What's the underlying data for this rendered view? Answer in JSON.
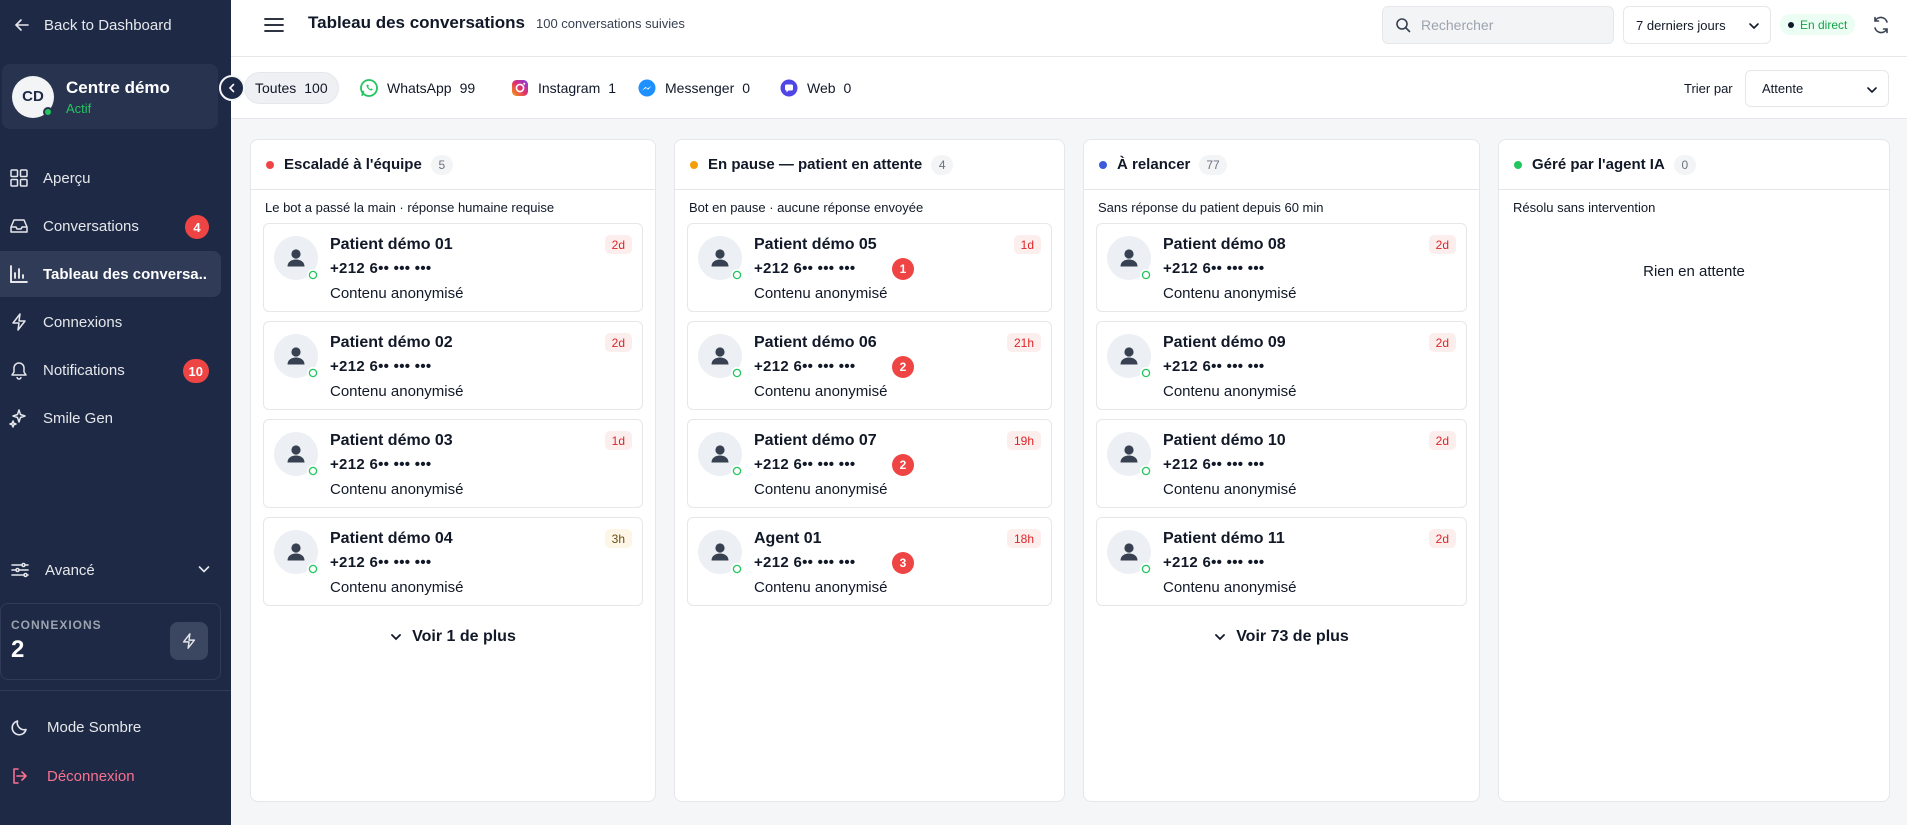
{
  "sidebar": {
    "back_label": "Back to Dashboard",
    "org": {
      "initials": "CD",
      "name": "Centre démo",
      "status": "Actif"
    },
    "items": [
      {
        "key": "apercu",
        "label": "Aperçu",
        "icon": "grid-icon"
      },
      {
        "key": "conversations",
        "label": "Conversations",
        "icon": "inbox-icon",
        "badge": "4"
      },
      {
        "key": "tableau",
        "label": "Tableau des conversa..",
        "icon": "bar-chart-icon",
        "active": true
      },
      {
        "key": "connexions",
        "label": "Connexions",
        "icon": "bolt-icon"
      },
      {
        "key": "notifications",
        "label": "Notifications",
        "icon": "bell-icon",
        "badge": "10"
      },
      {
        "key": "smile",
        "label": "Smile Gen",
        "icon": "sparkles-icon"
      }
    ],
    "advanced_label": "Avancé",
    "connections": {
      "label": "CONNEXIONS",
      "value": "2"
    },
    "dark_mode_label": "Mode Sombre",
    "logout_label": "Déconnexion"
  },
  "header": {
    "title": "Tableau des conversations",
    "subtitle": "100 conversations suivies",
    "search_placeholder": "Rechercher",
    "range_label": "7 derniers jours",
    "live_label": "En direct"
  },
  "filters": {
    "chips": [
      {
        "key": "all",
        "label": "Toutes",
        "count": "100",
        "active": true
      },
      {
        "key": "whatsapp",
        "label": "WhatsApp",
        "count": "99"
      },
      {
        "key": "instagram",
        "label": "Instagram",
        "count": "1"
      },
      {
        "key": "messenger",
        "label": "Messenger",
        "count": "0"
      },
      {
        "key": "web",
        "label": "Web",
        "count": "0"
      }
    ],
    "sort_label": "Trier par",
    "sort_value": "Attente"
  },
  "columns": [
    {
      "key": "escalade",
      "title": "Escaladé à l'équipe",
      "count": "5",
      "dot_color": "#ef4444",
      "description": "Le bot a passé la main · réponse humaine requise",
      "more_label": "Voir 1 de plus",
      "cards": [
        {
          "name": "Patient démo 01",
          "phone": "+212 6•• ••• •••",
          "message": "Contenu anonymisé",
          "age": "2d"
        },
        {
          "name": "Patient démo 02",
          "phone": "+212 6•• ••• •••",
          "message": "Contenu anonymisé",
          "age": "2d"
        },
        {
          "name": "Patient démo 03",
          "phone": "+212 6•• ••• •••",
          "message": "Contenu anonymisé",
          "age": "1d"
        },
        {
          "name": "Patient démo 04",
          "phone": "+212 6•• ••• •••",
          "message": "Contenu anonymisé",
          "age": "3h",
          "age_style": "warm"
        }
      ]
    },
    {
      "key": "pause",
      "title": "En pause — patient en attente",
      "count": "4",
      "dot_color": "#f59e0b",
      "description": "Bot en pause · aucune réponse envoyée",
      "cards": [
        {
          "name": "Patient démo 05",
          "phone": "+212 6•• ••• •••",
          "message": "Contenu anonymisé",
          "age": "1d",
          "unread": "1"
        },
        {
          "name": "Patient démo 06",
          "phone": "+212 6•• ••• •••",
          "message": "Contenu anonymisé",
          "age": "21h",
          "unread": "2"
        },
        {
          "name": "Patient démo 07",
          "phone": "+212 6•• ••• •••",
          "message": "Contenu anonymisé",
          "age": "19h",
          "unread": "2"
        },
        {
          "name": "Agent 01",
          "phone": "+212 6•• ••• •••",
          "message": "Contenu anonymisé",
          "age": "18h",
          "unread": "3"
        }
      ]
    },
    {
      "key": "relancer",
      "title": "À relancer",
      "count": "77",
      "dot_color": "#3b5bdb",
      "description": "Sans réponse du patient depuis 60 min",
      "more_label": "Voir 73 de plus",
      "cards": [
        {
          "name": "Patient démo 08",
          "phone": "+212 6•• ••• •••",
          "message": "Contenu anonymisé",
          "age": "2d"
        },
        {
          "name": "Patient démo 09",
          "phone": "+212 6•• ••• •••",
          "message": "Contenu anonymisé",
          "age": "2d"
        },
        {
          "name": "Patient démo 10",
          "phone": "+212 6•• ••• •••",
          "message": "Contenu anonymisé",
          "age": "2d"
        },
        {
          "name": "Patient démo 11",
          "phone": "+212 6•• ••• •••",
          "message": "Contenu anonymisé",
          "age": "2d"
        }
      ]
    },
    {
      "key": "ia",
      "title": "Géré par l'agent IA",
      "count": "0",
      "dot_color": "#22c55e",
      "description": "Résolu sans intervention",
      "empty_label": "Rien en attente",
      "cards": []
    }
  ]
}
